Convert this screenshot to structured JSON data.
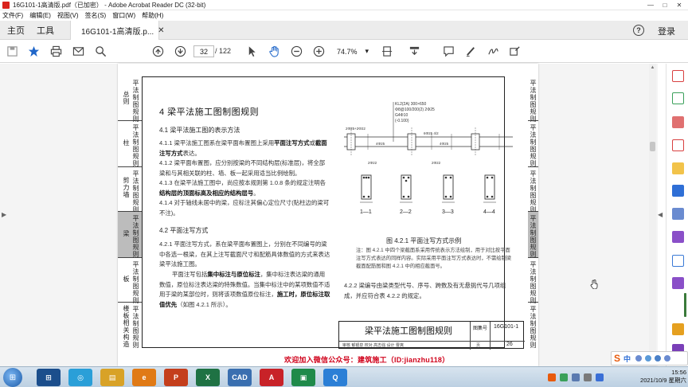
{
  "window": {
    "title": "16G101-1高清版.pdf（已加密） - Adobe Acrobat Reader DC (32-bit)",
    "controls": {
      "minimize": "—",
      "maximize": "□",
      "close": "✕"
    }
  },
  "menu": [
    "文件(F)",
    "编辑(E)",
    "视图(V)",
    "签名(S)",
    "窗口(W)",
    "帮助(H)"
  ],
  "tabs": {
    "home": "主页",
    "tools": "工具",
    "document": "16G101-1高清版.p...",
    "close": "✕",
    "help": "?",
    "login": "登录"
  },
  "toolbar": {
    "page_current": "32",
    "page_total": "/ 122",
    "zoom": "74.7%",
    "zoom_caret": "▾"
  },
  "pdf": {
    "left_tabs": [
      {
        "c1": "平法制图规则",
        "c2": "总则"
      },
      {
        "c1": "平法制图规则",
        "c2": "柱"
      },
      {
        "c1": "平法制图规则",
        "c2": "剪力墙"
      },
      {
        "c1": "平法制图规则",
        "c2": "梁"
      },
      {
        "c1": "平法制图规则",
        "c2": "板"
      },
      {
        "c1": "平法制图规则",
        "c2": "楼板相关构造"
      }
    ],
    "right_tabs": [
      "平法制图规则",
      "平法制图规则",
      "平法制图规则",
      "平法制图规则",
      "平法制图规则",
      "平法制图规则"
    ],
    "section_title": "4  梁平法施工图制图规则",
    "sub_41": "4.1  梁平法施工图的表示方法",
    "p411_a": "4.1.1  梁平法施工图系在梁平面布置图上采用",
    "p411_b": "平面注写方式",
    "p411_c": "或",
    "p411_d": "截面注写方式",
    "p411_e": "表达。",
    "p412": "4.1.2  梁平面布置图，应分别按梁的不同结构层(标准层)，将全部梁和与其相关联的柱、墙、板一起采用适当比例绘制。",
    "p413_a": "4.1.3  在梁平法施工图中，尚应按本规则第 1.0.8 条的规定注明各",
    "p413_b": "结构层的顶面标高及相应的结构层号",
    "p413_c": "。",
    "p414": "4.1.4  对于轴线未居中的梁，应标注其偏心定位尺寸(贴柱边的梁可不注)。",
    "sub_42": "4.2  平面注写方式",
    "p421": "4.2.1  平面注写方式，系在梁平面布置图上，分别在不同编号的梁中各选一根梁，在其上注写截面尺寸和配筋具体数值的方式来表达梁平法施工图。",
    "p421b_a": "平面注写包括",
    "p421b_b": "集中标注与原位标注",
    "p421b_c": "，集中标注表达梁的通用数值，原位标注表达梁的特殊数值。当集中标注中的某项数值不适用于梁的某部位时，则将该项数值原位标注，",
    "p421b_d": "施工时，原位标注取值优先",
    "p421b_e": "（如图 4.2.1 所示）。",
    "fig_caption": "图 4.2.1   平面注写方式示例",
    "fig_note": "注：图 4.2.1 中四个梁截面系采用传统表示方法绘制，用于对比按平面注写方式表达的同样内容。实际采用平面注写方式表达时，不需绘制梁截面配筋图和图 4.2.1 中的相应截面号。",
    "fig_labels": {
      "top1": "KL2(2A) 300×650",
      "top2": "Φ8@100/200(2) 2Φ25",
      "top3": "G4Φ10",
      "top4": "(-0.100)",
      "left1": "2Φ25+2Φ22",
      "mid1": "6Φ25 4/2",
      "mid2": "4Φ25",
      "sec1": "1—1",
      "sec2": "2—2",
      "sec3": "3—3",
      "sec4": "4—4"
    },
    "p422": "4.2.2  梁编号由梁类型代号、序号、跨数及有无悬挑代号几项组成，并应符合表 4.2.2 的规定。",
    "title_block": {
      "title": "梁平法施工图制图规则",
      "atlas_label": "图集号",
      "atlas_no": "16G101-1",
      "page_label": "页",
      "page_no": "26",
      "roles": "审核 郁银泉  校对 高志强  设计 曹爽"
    }
  },
  "watermark": "欢迎加入微信公众号：建筑施工（ID:jianzhu118）",
  "ime": {
    "logo": "S",
    "mode": "中"
  },
  "taskbar": {
    "apps": [
      {
        "label": "⊞",
        "color": "#1b4e8c"
      },
      {
        "label": "◎",
        "color": "#2a9fd8"
      },
      {
        "label": "▤",
        "color": "#d8a227"
      },
      {
        "label": "e",
        "color": "#e07a16"
      },
      {
        "label": "P",
        "color": "#c43e1c"
      },
      {
        "label": "X",
        "color": "#1f7244"
      },
      {
        "label": "CAD",
        "color": "#3a6fb0"
      },
      {
        "label": "A",
        "color": "#c82228"
      },
      {
        "label": "▣",
        "color": "#1f8a4a"
      },
      {
        "label": "Q",
        "color": "#2b7fd6"
      }
    ],
    "time": "15:56",
    "date": "2021/10/9 星期六"
  }
}
